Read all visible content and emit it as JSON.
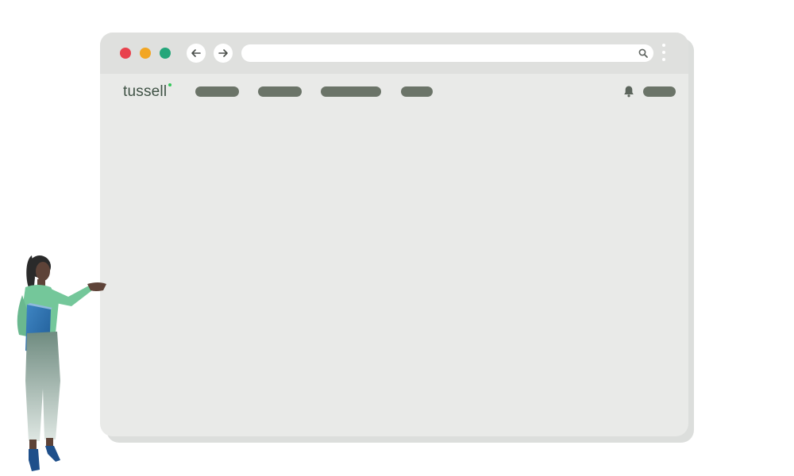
{
  "app": {
    "logo_text": "tussell"
  },
  "colors": {
    "close": "#e8424d",
    "minimize": "#f2a623",
    "maximize": "#24a67a",
    "nav_placeholder": "#6b7468",
    "logo_accent": "#34c759"
  },
  "icons": [
    "arrow-left-icon",
    "arrow-right-icon",
    "search-icon",
    "more-vertical-icon",
    "bell-icon"
  ]
}
